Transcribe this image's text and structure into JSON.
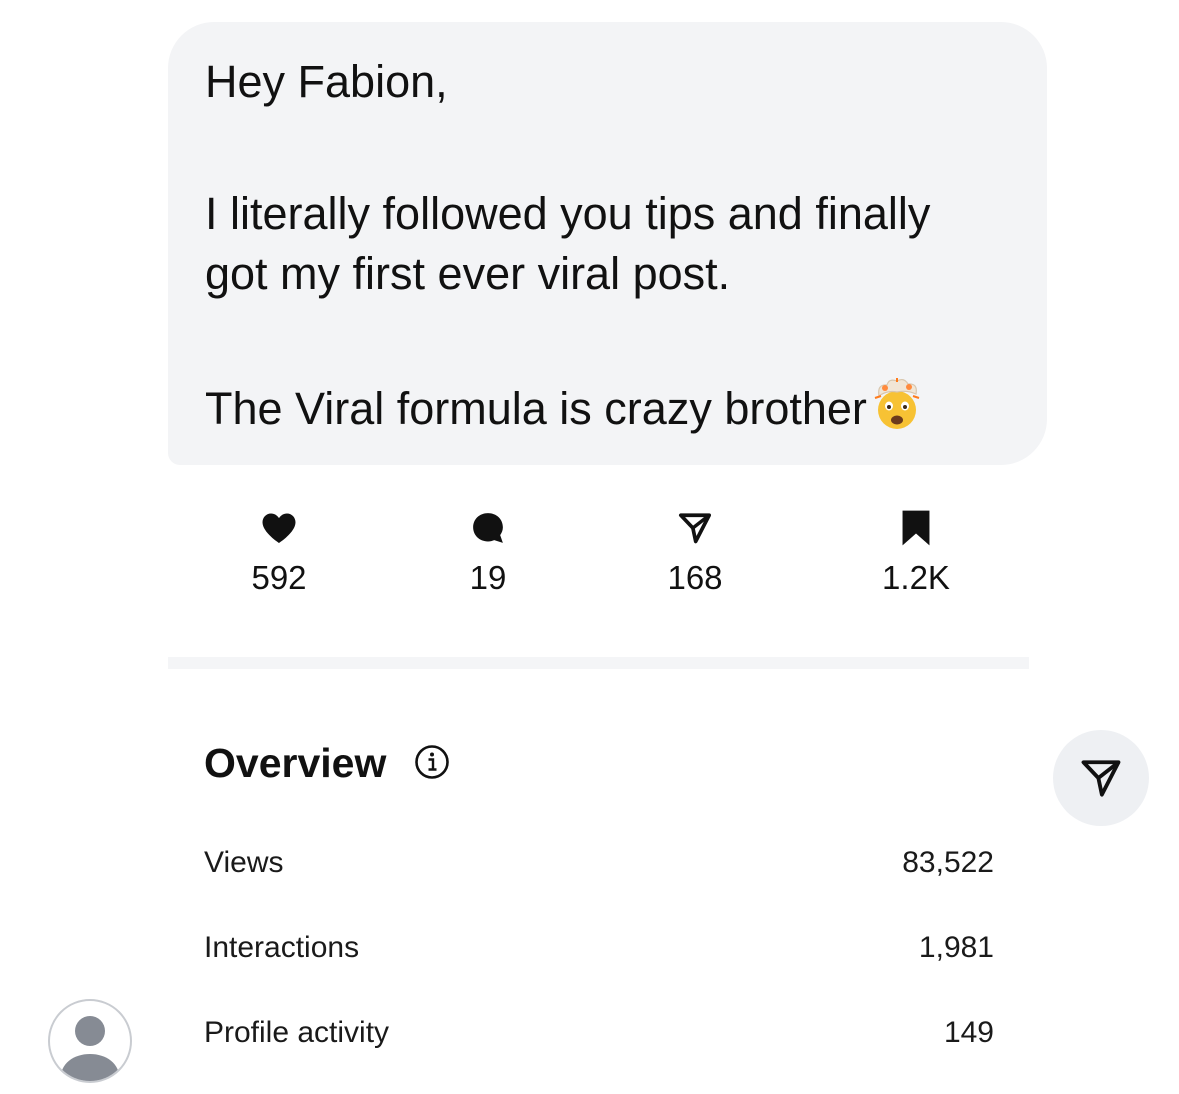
{
  "message": {
    "greeting": "Hey Fabion,",
    "line1": "I literally followed you tips and finally",
    "line2": "got my first ever viral post.",
    "line3": "The Viral formula is crazy brother",
    "emoji": "exploding-head-emoji"
  },
  "stats": {
    "likes": "592",
    "comments": "19",
    "shares": "168",
    "saves": "1.2K"
  },
  "overview": {
    "title": "Overview",
    "rows": [
      {
        "label": "Views",
        "value": "83,522"
      },
      {
        "label": "Interactions",
        "value": "1,981"
      },
      {
        "label": "Profile activity",
        "value": "149"
      }
    ]
  },
  "icons": {
    "like": "heart-icon",
    "comment": "comment-bubble-icon",
    "share": "send-icon",
    "save": "bookmark-icon",
    "info": "info-icon",
    "fab": "send-icon",
    "avatar": "default-avatar-icon"
  },
  "colors": {
    "bubble_bg": "#f3f4f6",
    "text": "#111111",
    "fab_bg": "#eef0f3",
    "avatar_gray": "#868b94"
  }
}
